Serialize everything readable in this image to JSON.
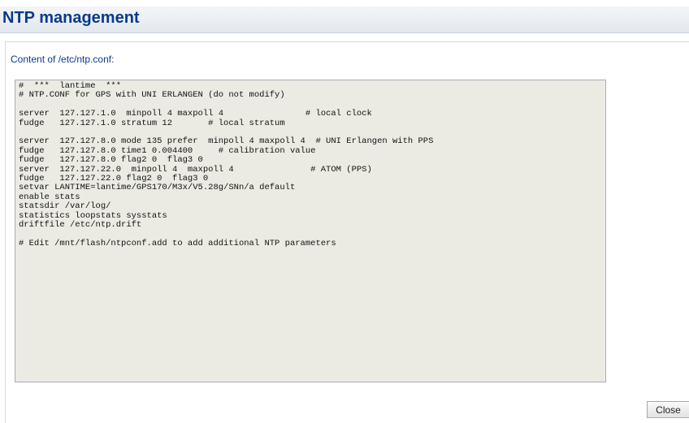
{
  "header": {
    "title": "NTP management"
  },
  "main": {
    "content_label": "Content of /etc/ntp.conf:",
    "ntp_conf_content": "#  ***  lantime  ***\n# NTP.CONF for GPS with UNI ERLANGEN (do not modify)\n\nserver  127.127.1.0  minpoll 4 maxpoll 4                # local clock\nfudge   127.127.1.0 stratum 12       # local stratum\n\nserver  127.127.8.0 mode 135 prefer  minpoll 4 maxpoll 4  # UNI Erlangen with PPS\nfudge   127.127.8.0 time1 0.004400     # calibration value\nfudge   127.127.8.0 flag2 0  flag3 0\nserver  127.127.22.0  minpoll 4  maxpoll 4               # ATOM (PPS)\nfudge   127.127.22.0 flag2 0  flag3 0\nsetvar LANTIME=lantime/GPS170/M3x/V5.28g/SNn/a default\nenable stats\nstatsdir /var/log/\nstatistics loopstats sysstats\ndriftfile /etc/ntp.drift\n\n# Edit /mnt/flash/ntpconf.add to add additional NTP parameters"
  },
  "footer": {
    "close_label": "Close"
  },
  "colors": {
    "title_text": "#0b3a8a",
    "label_text": "#0b3a8a",
    "textarea_background": "#ebebe4"
  }
}
